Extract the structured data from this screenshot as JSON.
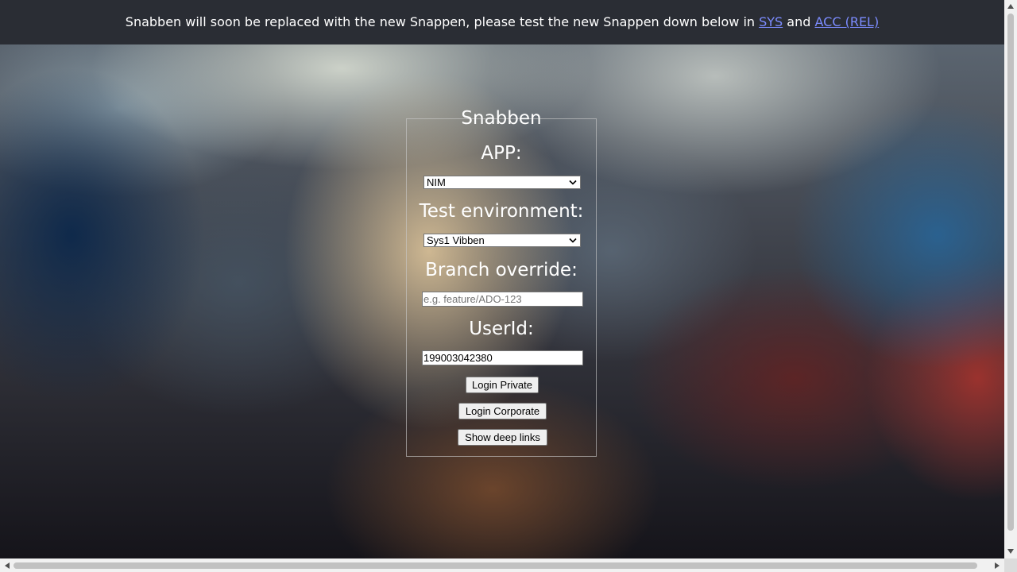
{
  "banner": {
    "text_before": "Snabben will soon be replaced with the new Snappen, please test the new Snappen down below in ",
    "link_sys": "SYS",
    "text_middle": " and ",
    "link_acc": "ACC (REL)",
    "link_color": "#7c8cff"
  },
  "form": {
    "title": "Snabben",
    "app_label": "APP:",
    "app_value": "NIM",
    "env_label": "Test environment:",
    "env_value": "Sys1 Vibben",
    "branch_label": "Branch override:",
    "branch_placeholder": "e.g. feature/ADO-123",
    "branch_value": "",
    "userid_label": "UserId:",
    "userid_value": "199003042380",
    "login_private_label": "Login Private",
    "login_corporate_label": "Login Corporate",
    "deep_links_label": "Show deep links"
  },
  "icons": {
    "select_chevron": "chevron-down-icon",
    "scroll_up": "arrow-up-icon",
    "scroll_down": "arrow-down-icon",
    "scroll_left": "arrow-left-icon",
    "scroll_right": "arrow-right-icon"
  }
}
